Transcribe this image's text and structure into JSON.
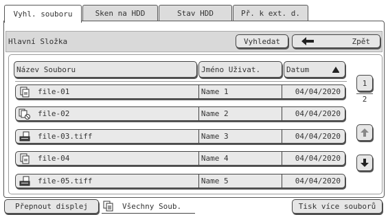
{
  "tabs": [
    {
      "label": "Vyhl. souboru",
      "active": true
    },
    {
      "label": "Sken na HDD",
      "active": false
    },
    {
      "label": "Stav HDD",
      "active": false
    },
    {
      "label": "Př. k ext. d.",
      "active": false
    }
  ],
  "topbar": {
    "folder": "Hlavní Složka",
    "search_label": "Vyhledat",
    "back_label": "Zpět",
    "back_icon": "left-arrow-icon"
  },
  "columns": {
    "name": "Název Souboru",
    "user": "Jméno Uživat.",
    "date": "Datum",
    "sort_icon": "sort-up-triangle-icon"
  },
  "files": [
    {
      "icon": "copy-doc-icon",
      "name": "file-01",
      "user": "Name 1",
      "date": "04/04/2020"
    },
    {
      "icon": "copy-doc-no-icon",
      "name": "file-02",
      "user": "Name 2",
      "date": "04/04/2020"
    },
    {
      "icon": "scanner-doc-icon",
      "name": "file-03.tiff",
      "user": "Name 3",
      "date": "04/04/2020"
    },
    {
      "icon": "copy-doc-icon",
      "name": "file-04",
      "user": "Name 4",
      "date": "04/04/2020"
    },
    {
      "icon": "scanner-doc-icon",
      "name": "file-05.tiff",
      "user": "Name 5",
      "date": "04/04/2020"
    }
  ],
  "pager": {
    "page": "1",
    "total": "2",
    "up_icon": "up-arrow-icon",
    "down_icon": "down-arrow-icon"
  },
  "bottom": {
    "switch_label": "Přepnout displej",
    "filter_label": "Všechny Soub.",
    "filter_icon": "documents-icon",
    "print_label": "Tisk více souborů"
  }
}
